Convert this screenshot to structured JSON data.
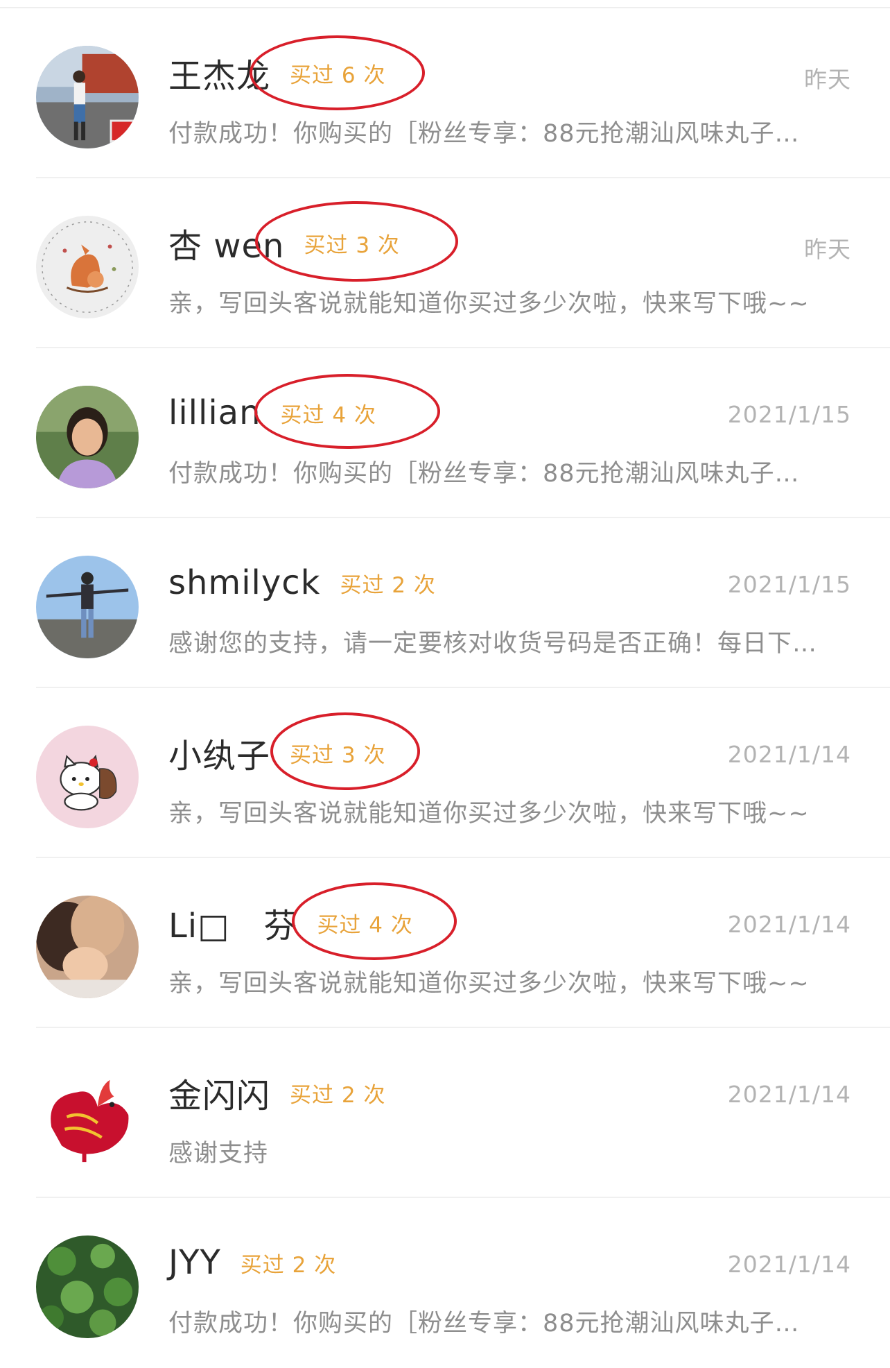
{
  "conversations": [
    {
      "name": "王杰龙",
      "badge": "买过 6 次",
      "badge_circled": true,
      "time": "昨天",
      "preview": "付款成功！你购买的［粉丝专享：88元抢潮汕风味丸子…"
    },
    {
      "name": "杏 wen",
      "badge": "买过 3 次",
      "badge_circled": true,
      "time": "昨天",
      "preview": "亲，写回头客说就能知道你买过多少次啦，快来写下哦~~"
    },
    {
      "name": "lillian",
      "badge": "买过 4 次",
      "badge_circled": true,
      "time": "2021/1/15",
      "preview": "付款成功！你购买的［粉丝专享：88元抢潮汕风味丸子…"
    },
    {
      "name": "shmilyck",
      "badge": "买过 2 次",
      "badge_circled": false,
      "time": "2021/1/15",
      "preview": "感谢您的支持，请一定要核对收货号码是否正确！每日下…"
    },
    {
      "name": "小纨子",
      "badge": "买过 3 次",
      "badge_circled": true,
      "time": "2021/1/14",
      "preview": "亲，写回头客说就能知道你买过多少次啦，快来写下哦~~"
    },
    {
      "name": "Li□　芬",
      "badge": "买过 4 次",
      "badge_circled": true,
      "time": "2021/1/14",
      "preview": "亲，写回头客说就能知道你买过多少次啦，快来写下哦~~"
    },
    {
      "name": "金闪闪",
      "badge": "买过 2 次",
      "badge_circled": false,
      "time": "2021/1/14",
      "preview": "感谢支持"
    },
    {
      "name": "JYY",
      "badge": "买过 2 次",
      "badge_circled": false,
      "time": "2021/1/14",
      "preview": "付款成功！你购买的［粉丝专享：88元抢潮汕风味丸子…"
    }
  ],
  "colors": {
    "badge": "#e8a33a",
    "annotation_ring": "#d81f2a",
    "name": "#2b2b2b",
    "preview": "#8e8e8e",
    "time": "#b3b3b3"
  }
}
